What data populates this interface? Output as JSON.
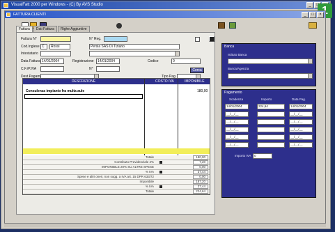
{
  "outer_window": {
    "title": "VisualFatt 2000 per Windows - (C) By AVS Studio",
    "buttons": [
      "_",
      "□",
      "×"
    ]
  },
  "badge": "1",
  "inner_window": {
    "title": "FATTURA CLIENTI",
    "buttons": [
      "_",
      "□",
      "×"
    ]
  },
  "tabs": [
    "Fattura",
    "Dati Fattura",
    "Righe Aggiuntive"
  ],
  "form": {
    "labels": {
      "fattura": "Fattura N°",
      "n_reg": "N° Reg.",
      "cod_inglese": "Cod.Inglese",
      "intestatario": "Intestatario",
      "data_fattura": "Data Fattura",
      "registrazione": "Registrazione",
      "codice": "Codice",
      "cf_pi": "C.F./P.IVA",
      "iva": "N°",
      "dest_pagamento": "Dest.Pagamento",
      "tipo_pag": "Tipo Pag."
    },
    "values": {
      "fattura": "",
      "n_reg": "",
      "cod_cliente": "C",
      "cod_cliente_name": "Rossi",
      "intestatario_code": "",
      "intestatario_name": "Persia SAS Di Tiziano",
      "data_fattura": "14/01/2004",
      "registrazione": "14/01/2004",
      "codice": "0"
    },
    "cerca_label": "Cerca"
  },
  "items_table": {
    "headers": [
      "DESCRIZIONE",
      "COSTO IVA",
      "IMPONIBILE"
    ],
    "rows": [
      {
        "description": "Consulenza impianto fra multa aule",
        "amount": "180,00"
      }
    ]
  },
  "totals": [
    {
      "label": "Totale",
      "value": "180,00",
      "mark": false
    },
    {
      "label": "Contributo Previdenziale 4%",
      "value": "7,20",
      "mark": true
    },
    {
      "label": "IMPONIBILE 20% SU ALTRE SPESE",
      "value": "0,00",
      "mark": false
    },
    {
      "label": "% IVA",
      "value": "37,44",
      "mark": true
    },
    {
      "label": "Spese e altri oneri, non sogg. a IVA art. 15 DPR 633/72",
      "value": "0,00",
      "mark": false
    },
    {
      "label": "Imponibile",
      "value": "187,20",
      "mark": false
    },
    {
      "label": "% IVA",
      "value": "37,44",
      "mark": true
    },
    {
      "label": "Totale",
      "value": "224,64",
      "mark": false
    }
  ],
  "banca_panel": {
    "title": "Banca",
    "agenzia_label": "Istituto Banca",
    "banca_label": "Banca/Agenzia"
  },
  "pagamento_panel": {
    "title": "Pagamento",
    "headers": [
      "Scadenza",
      "Importo",
      "Data Pag."
    ],
    "rows": [
      [
        "14/01/2004",
        "224,64",
        "14/01/2004"
      ],
      [
        "__/__/__",
        "",
        "__/__/__"
      ],
      [
        "__/__/__",
        "",
        "__/__/__"
      ],
      [
        "__/__/__",
        "",
        "__/__/__"
      ],
      [
        "__/__/__",
        "",
        "__/__/__"
      ],
      [
        "__/__/__",
        "",
        "__/__/__"
      ]
    ],
    "imp_label": "Importo IVA",
    "imp_value": "0"
  }
}
